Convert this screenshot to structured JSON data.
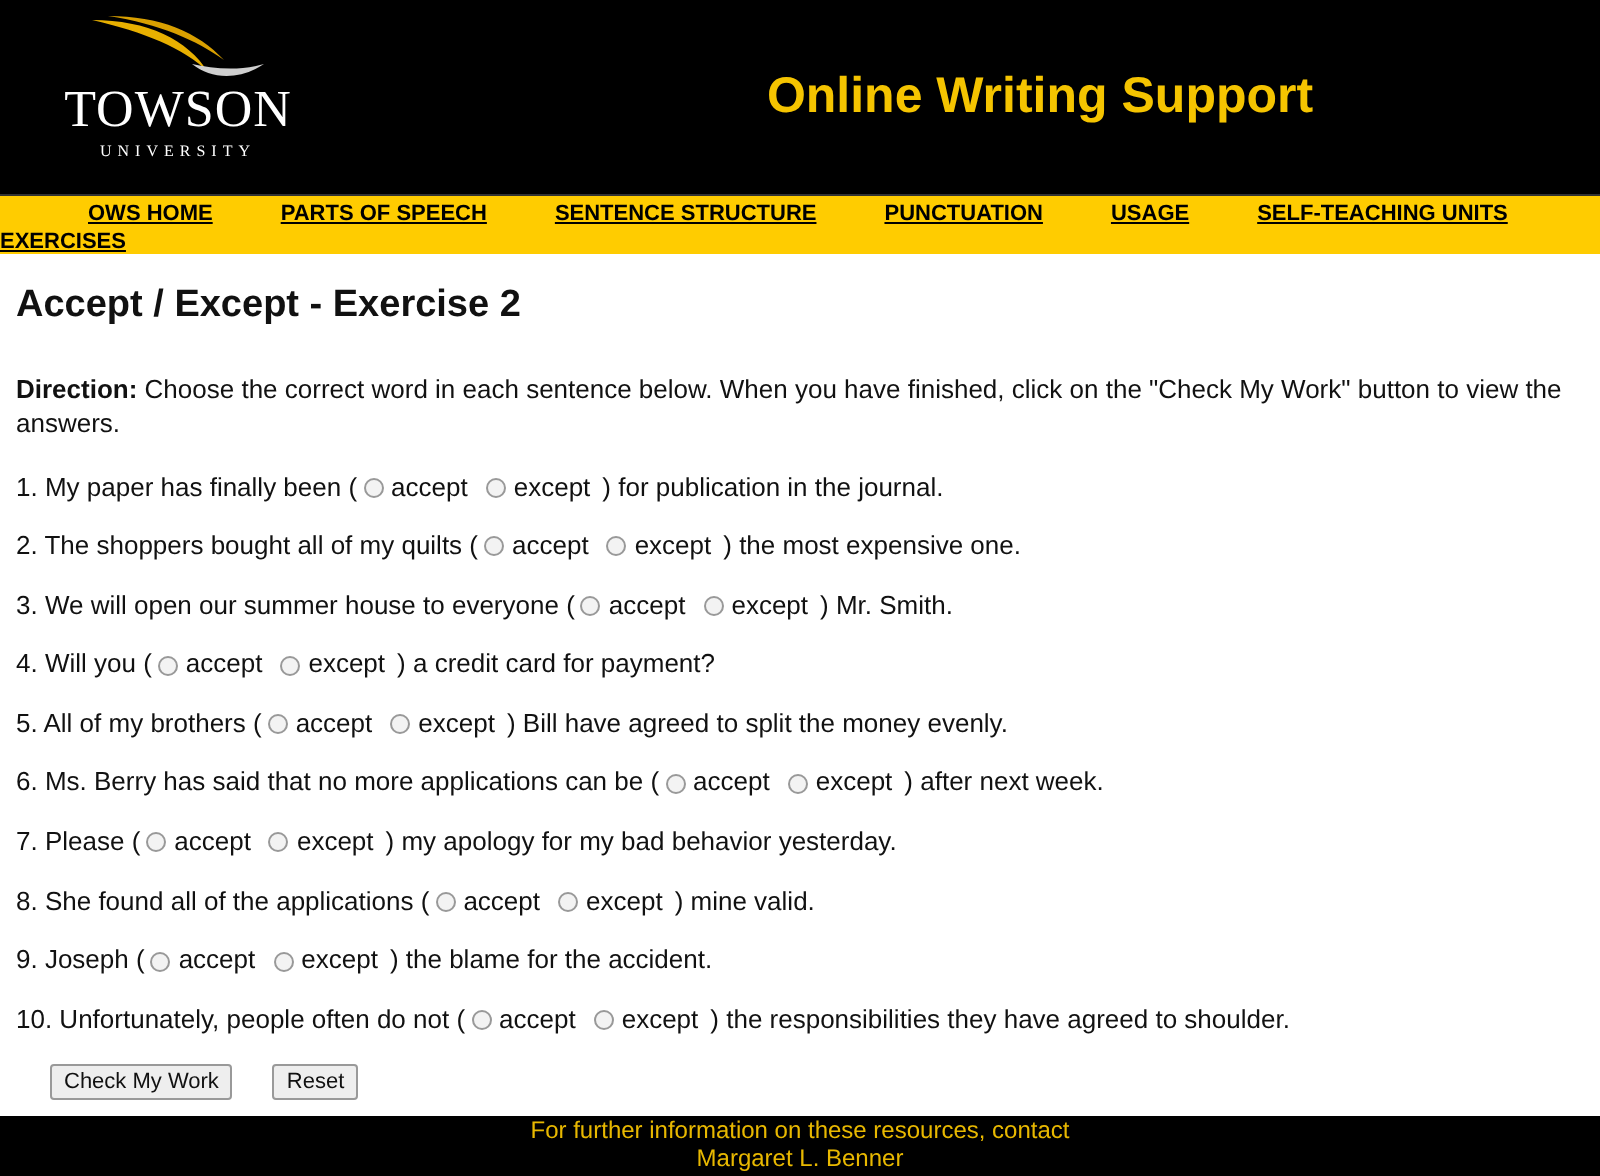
{
  "header": {
    "logo_name": "TOWSON",
    "logo_sub": "UNIVERSITY",
    "title": "Online Writing Support"
  },
  "nav": [
    "OWS HOME",
    "PARTS OF SPEECH",
    "SENTENCE STRUCTURE",
    "PUNCTUATION",
    "USAGE",
    "SELF-TEACHING UNITS",
    "EXERCISES"
  ],
  "page_title": "Accept / Except - Exercise 2",
  "direction": {
    "label": "Direction:",
    "text": "Choose the correct word in each sentence below. When you have finished, click on the \"Check My Work\" button to view the answers."
  },
  "questions": [
    {
      "before": "1. My paper has finally been (",
      "options": [
        {
          "label": "accept",
          "selected": false
        },
        {
          "label": "except",
          "selected": false
        }
      ],
      "after": ") for publication in the journal."
    },
    {
      "before": "2. The shoppers bought all of my quilts (",
      "options": [
        {
          "label": "accept",
          "selected": false
        },
        {
          "label": "except",
          "selected": false
        }
      ],
      "after": ") the most expensive one."
    },
    {
      "before": "3. We will open our summer house to everyone (",
      "options": [
        {
          "label": "accept",
          "selected": false
        },
        {
          "label": "except",
          "selected": false
        }
      ],
      "after": ") Mr. Smith."
    },
    {
      "before": "4. Will you (",
      "options": [
        {
          "label": "accept",
          "selected": false
        },
        {
          "label": "except",
          "selected": false
        }
      ],
      "after": ") a credit card for payment?"
    },
    {
      "before": "5. All of my brothers (",
      "options": [
        {
          "label": "accept",
          "selected": false
        },
        {
          "label": "except",
          "selected": false
        }
      ],
      "after": ") Bill have agreed to split the money evenly."
    },
    {
      "before": "6. Ms. Berry has said that no more applications can be (",
      "options": [
        {
          "label": "accept",
          "selected": false
        },
        {
          "label": "except",
          "selected": false
        }
      ],
      "after": ") after next week."
    },
    {
      "before": "7. Please (",
      "options": [
        {
          "label": "accept",
          "selected": false
        },
        {
          "label": "except",
          "selected": false
        }
      ],
      "after": ") my apology for my bad behavior yesterday."
    },
    {
      "before": "8. She found all of the applications (",
      "options": [
        {
          "label": "accept",
          "selected": false
        },
        {
          "label": "except",
          "selected": false
        }
      ],
      "after": ") mine valid."
    },
    {
      "before": "9. Joseph (",
      "options": [
        {
          "label": "accept",
          "selected": false
        },
        {
          "label": "except",
          "selected": false
        }
      ],
      "after": ") the blame for the accident."
    },
    {
      "before": "10. Unfortunately, people often do not (",
      "options": [
        {
          "label": "accept",
          "selected": false
        },
        {
          "label": "except",
          "selected": false
        }
      ],
      "after": ") the responsibilities they have agreed to shoulder."
    }
  ],
  "buttons": [
    "Check My Work",
    "Reset"
  ],
  "footer": {
    "line_1": "For further information on these resources, contact",
    "line_2": "Margaret L. Benner"
  }
}
